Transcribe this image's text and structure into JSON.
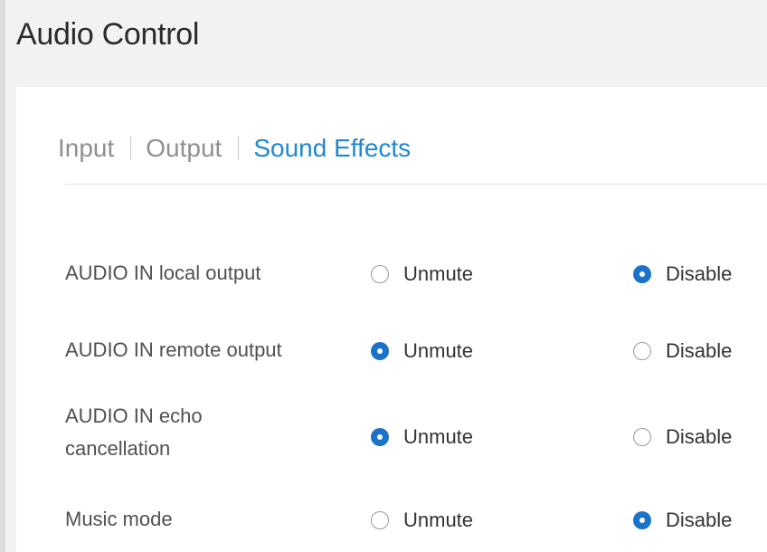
{
  "page": {
    "title": "Audio Control"
  },
  "tabs": [
    {
      "label": "Input",
      "active": false
    },
    {
      "label": "Output",
      "active": false
    },
    {
      "label": "Sound Effects",
      "active": true
    }
  ],
  "colors": {
    "accent": "#1e88d2",
    "radio_checked": "#1a73c8"
  },
  "settings": [
    {
      "label": "AUDIO IN local output",
      "options": [
        {
          "label": "Unmute",
          "checked": false
        },
        {
          "label": "Disable",
          "checked": true
        }
      ]
    },
    {
      "label": "AUDIO IN remote output",
      "options": [
        {
          "label": "Unmute",
          "checked": true
        },
        {
          "label": "Disable",
          "checked": false
        }
      ]
    },
    {
      "label": "AUDIO IN echo cancellation",
      "options": [
        {
          "label": "Unmute",
          "checked": true
        },
        {
          "label": "Disable",
          "checked": false
        }
      ]
    },
    {
      "label": "Music mode",
      "options": [
        {
          "label": "Unmute",
          "checked": false
        },
        {
          "label": "Disable",
          "checked": true
        }
      ]
    }
  ]
}
